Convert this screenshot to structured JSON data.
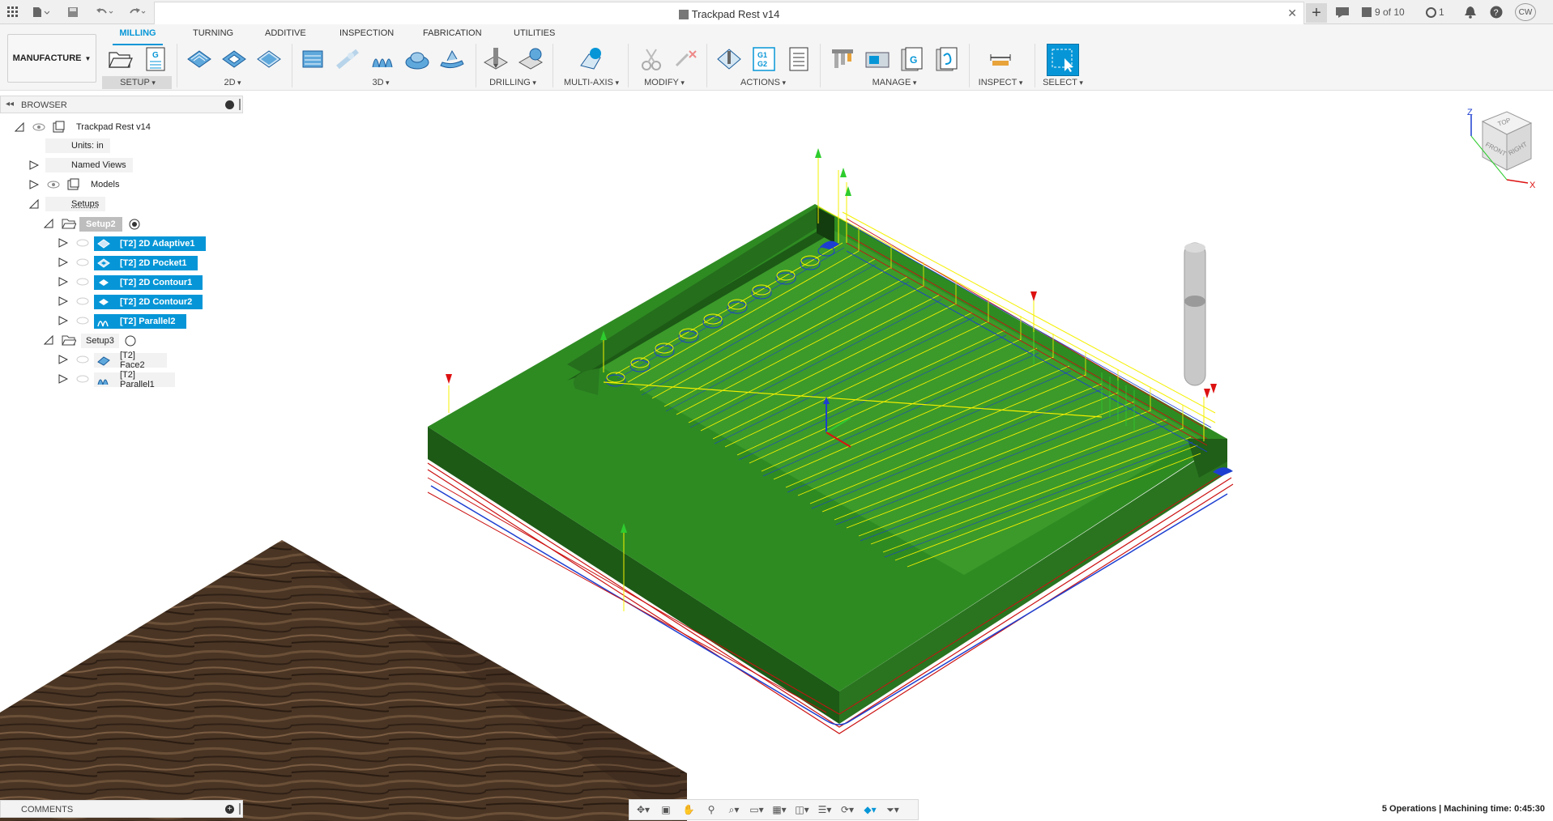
{
  "app": {
    "document_title": "Trackpad Rest v14",
    "version_counter": "9 of 10",
    "jobs_count": "1",
    "user_initials": "CW"
  },
  "ribbon": {
    "workspace": "MANUFACTURE",
    "tabs": [
      "MILLING",
      "TURNING",
      "ADDITIVE",
      "INSPECTION",
      "FABRICATION",
      "UTILITIES"
    ],
    "active_tab": "MILLING",
    "groups": [
      "SETUP",
      "2D",
      "3D",
      "DRILLING",
      "MULTI-AXIS",
      "MODIFY",
      "ACTIONS",
      "MANAGE",
      "INSPECT",
      "SELECT"
    ],
    "gcode_icon_text": "G1\nG2"
  },
  "browser": {
    "title": "BROWSER",
    "items": [
      {
        "label": "Trackpad Rest v14",
        "level": 0,
        "expanded": true
      },
      {
        "label": "Units: in",
        "level": 1
      },
      {
        "label": "Named Views",
        "level": 1,
        "expanded": false
      },
      {
        "label": "Models",
        "level": 1,
        "expanded": false
      },
      {
        "label": "Setups",
        "level": 1,
        "expanded": true
      },
      {
        "label": "Setup2",
        "level": 2,
        "expanded": true,
        "active": true
      },
      {
        "label": "[T2] 2D Adaptive1",
        "level": 3,
        "selected": true
      },
      {
        "label": "[T2] 2D Pocket1",
        "level": 3,
        "selected": true
      },
      {
        "label": "[T2] 2D Contour1",
        "level": 3,
        "selected": true
      },
      {
        "label": "[T2] 2D Contour2",
        "level": 3,
        "selected": true
      },
      {
        "label": "[T2] Parallel2",
        "level": 3,
        "selected": true
      },
      {
        "label": "Setup3",
        "level": 2,
        "expanded": true
      },
      {
        "label": "[T2] Face2",
        "level": 3
      },
      {
        "label": "[T2] Parallel1",
        "level": 3
      }
    ]
  },
  "viewcube": {
    "top": "TOP",
    "front": "FRONT",
    "right": "RIGHT",
    "axis_z": "Z",
    "axis_x": "X"
  },
  "comments": {
    "title": "COMMENTS"
  },
  "status": {
    "text": "5 Operations | Machining time: 0:45:30"
  },
  "colors": {
    "accent": "#0696d7",
    "stock_top": "#2e8b22",
    "stock_side_dark": "#1f5f17",
    "toolpath_yellow": "#f4f000",
    "toolpath_blue": "#1d3fd1",
    "toolpath_red": "#cc1111",
    "wood": "#4a3524"
  }
}
